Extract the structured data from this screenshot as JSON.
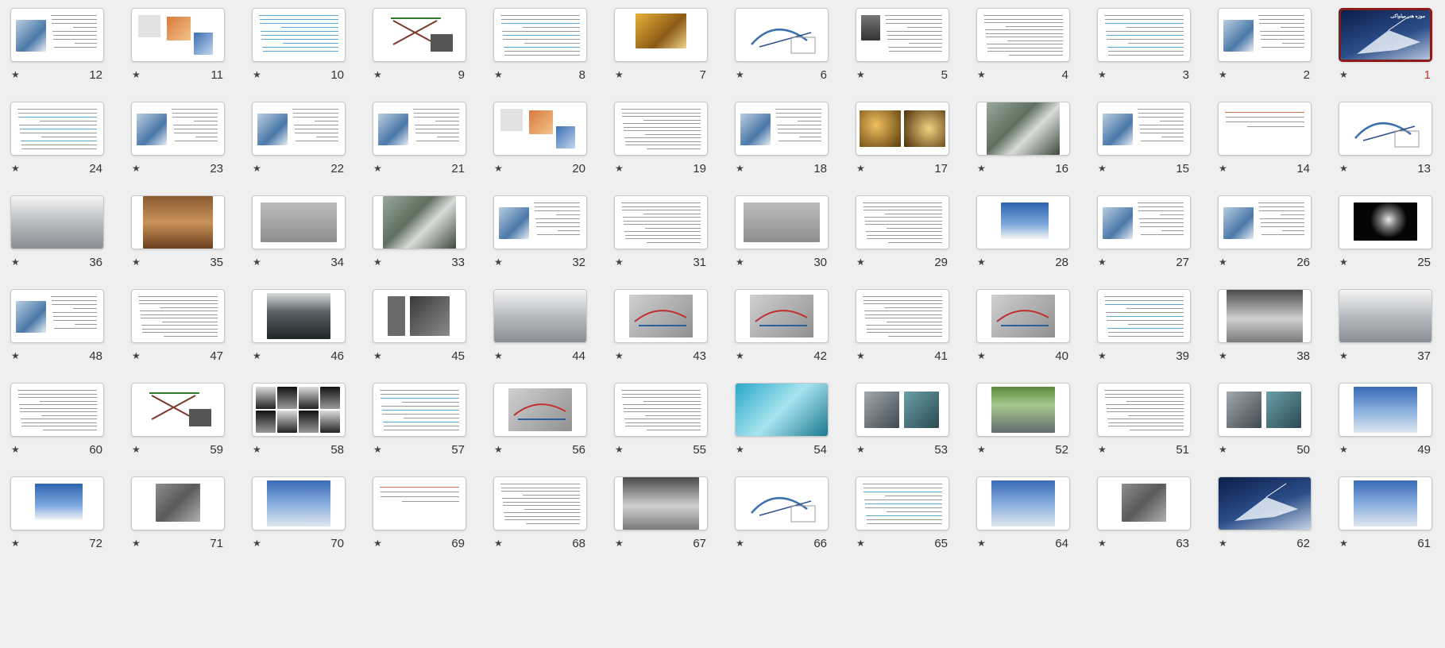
{
  "selected_slide": 1,
  "star_glyph": "★",
  "slides": [
    {
      "n": 1,
      "style": "dark-photo",
      "title": "موزه هنر میلواکی"
    },
    {
      "n": 2,
      "style": "text-pic-l",
      "title": ""
    },
    {
      "n": 3,
      "style": "text-blue"
    },
    {
      "n": 4,
      "style": "text-dense"
    },
    {
      "n": 5,
      "style": "portrait-text"
    },
    {
      "n": 6,
      "style": "diagram"
    },
    {
      "n": 7,
      "style": "pic-center-yellow"
    },
    {
      "n": 8,
      "style": "text-blue"
    },
    {
      "n": 9,
      "style": "sketch"
    },
    {
      "n": 10,
      "style": "text-light"
    },
    {
      "n": 11,
      "style": "sketch-multi"
    },
    {
      "n": 12,
      "style": "text-pic-l"
    },
    {
      "n": 13,
      "style": "diagram"
    },
    {
      "n": 14,
      "style": "text-sparse"
    },
    {
      "n": 15,
      "style": "text-pic-l"
    },
    {
      "n": 16,
      "style": "aerial"
    },
    {
      "n": 17,
      "style": "two-warm"
    },
    {
      "n": 18,
      "style": "text-pic-l"
    },
    {
      "n": 19,
      "style": "text-dense"
    },
    {
      "n": 20,
      "style": "sketch-multi"
    },
    {
      "n": 21,
      "style": "text-pic-l"
    },
    {
      "n": 22,
      "style": "text-pic-l"
    },
    {
      "n": 23,
      "style": "text-pic-l"
    },
    {
      "n": 24,
      "style": "text-blue"
    },
    {
      "n": 25,
      "style": "night"
    },
    {
      "n": 26,
      "style": "text-pic-l"
    },
    {
      "n": 27,
      "style": "text-pic-l"
    },
    {
      "n": 28,
      "style": "pic-center-sky"
    },
    {
      "n": 29,
      "style": "text-dense"
    },
    {
      "n": 30,
      "style": "gray-plan"
    },
    {
      "n": 31,
      "style": "text-dense"
    },
    {
      "n": 32,
      "style": "text-pic-l"
    },
    {
      "n": 33,
      "style": "aerial"
    },
    {
      "n": 34,
      "style": "gray-plan"
    },
    {
      "n": 35,
      "style": "warm-full"
    },
    {
      "n": 36,
      "style": "interior-full"
    },
    {
      "n": 37,
      "style": "interior-full"
    },
    {
      "n": 38,
      "style": "gray-full"
    },
    {
      "n": 39,
      "style": "text-blue"
    },
    {
      "n": 40,
      "style": "section-drawing"
    },
    {
      "n": 41,
      "style": "text-dense"
    },
    {
      "n": 42,
      "style": "section-drawing"
    },
    {
      "n": 43,
      "style": "section-drawing"
    },
    {
      "n": 44,
      "style": "interior-full"
    },
    {
      "n": 45,
      "style": "two-dark"
    },
    {
      "n": 46,
      "style": "dark-interior"
    },
    {
      "n": 47,
      "style": "text-dense"
    },
    {
      "n": 48,
      "style": "text-pic-l"
    },
    {
      "n": 49,
      "style": "sky-full"
    },
    {
      "n": 50,
      "style": "two-gray"
    },
    {
      "n": 51,
      "style": "text-dense"
    },
    {
      "n": 52,
      "style": "green-full"
    },
    {
      "n": 53,
      "style": "two-gray"
    },
    {
      "n": 54,
      "style": "cyan-full"
    },
    {
      "n": 55,
      "style": "text-dense"
    },
    {
      "n": 56,
      "style": "section-drawing"
    },
    {
      "n": 57,
      "style": "text-blue"
    },
    {
      "n": 58,
      "style": "bw-grid"
    },
    {
      "n": 59,
      "style": "sketch"
    },
    {
      "n": 60,
      "style": "text-dense"
    },
    {
      "n": 61,
      "style": "sky-full"
    },
    {
      "n": 62,
      "style": "dark-photo"
    },
    {
      "n": 63,
      "style": "pic-center-gray"
    },
    {
      "n": 64,
      "style": "sky-full"
    },
    {
      "n": 65,
      "style": "text-blue"
    },
    {
      "n": 66,
      "style": "diagram"
    },
    {
      "n": 67,
      "style": "gray-full"
    },
    {
      "n": 68,
      "style": "text-dense"
    },
    {
      "n": 69,
      "style": "text-sparse"
    },
    {
      "n": 70,
      "style": "sky-full"
    },
    {
      "n": 71,
      "style": "pic-center-gray"
    },
    {
      "n": 72,
      "style": "pic-center-sky"
    }
  ]
}
